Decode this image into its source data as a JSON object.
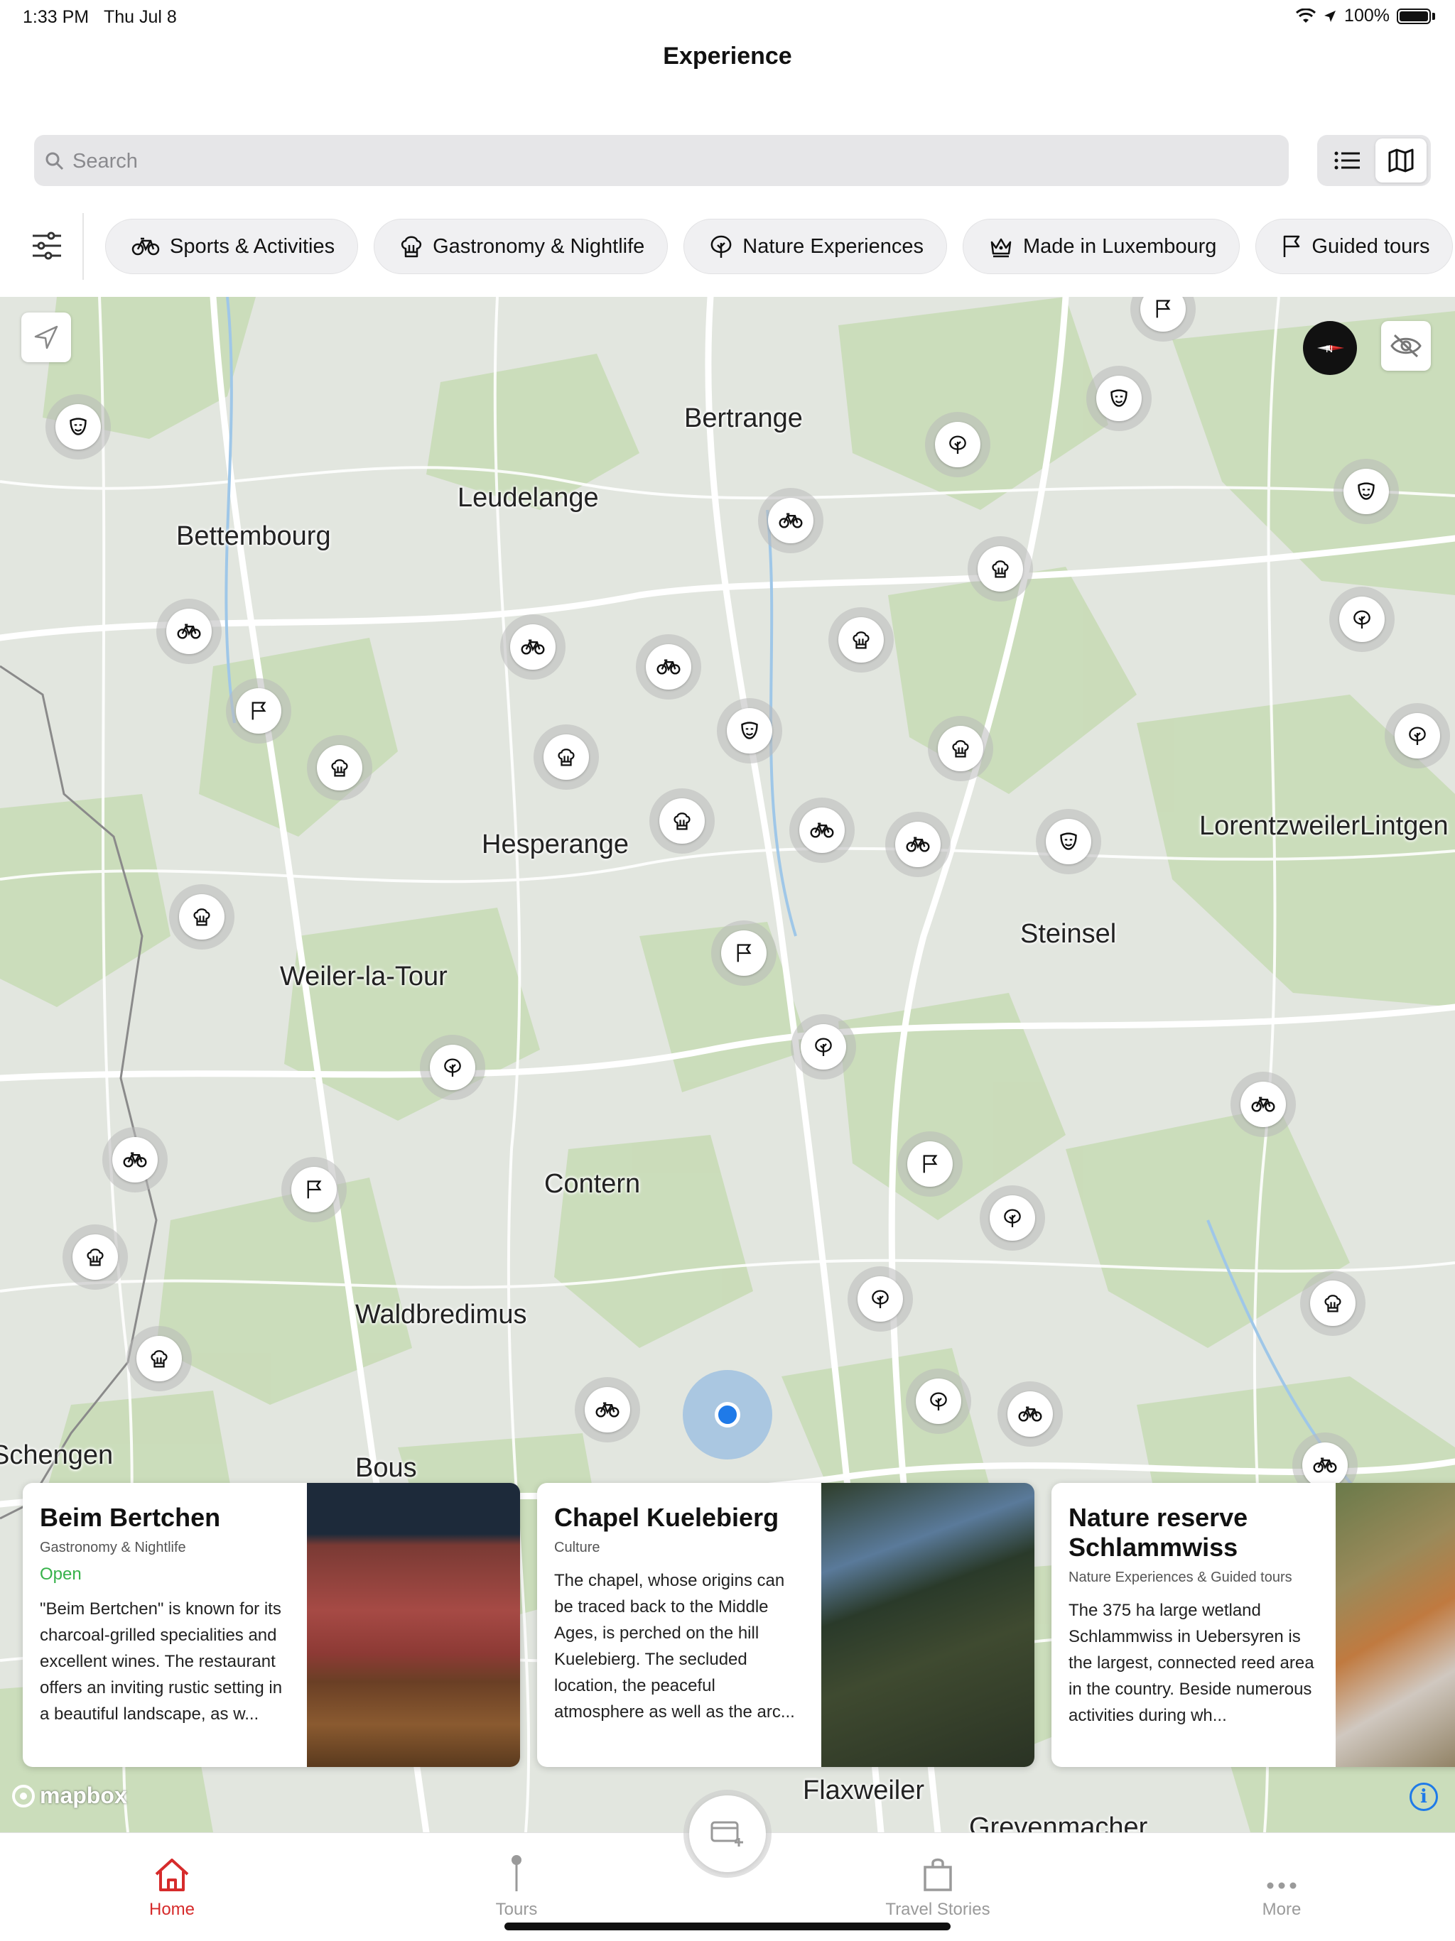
{
  "status_bar": {
    "time": "1:33 PM",
    "date": "Thu Jul 8",
    "battery": "100%"
  },
  "header": {
    "title": "Experience"
  },
  "search": {
    "placeholder": "Search",
    "value": ""
  },
  "view_toggle": {
    "options": [
      "list-icon",
      "map-icon"
    ],
    "selected": "map"
  },
  "categories": [
    {
      "label": "Sports & Activities",
      "icon": "bike-icon"
    },
    {
      "label": "Gastronomy & Nightlife",
      "icon": "chef-hat-icon"
    },
    {
      "label": "Nature Experiences",
      "icon": "tree-icon"
    },
    {
      "label": "Made in Luxembourg",
      "icon": "crown-icon"
    },
    {
      "label": "Guided tours",
      "icon": "flag-icon"
    }
  ],
  "map": {
    "places": [
      "Bertrange",
      "Leudelange",
      "Bettembourg",
      "Hesperange",
      "LorentzweilerLintgen",
      "Steinsel",
      "Weiler-la-Tour",
      "Contern",
      "Waldbredimus",
      "Schengen",
      "Bous",
      "Flaxweiler",
      "Grevenmacher"
    ],
    "attribution": "mapbox",
    "compass_label": "N"
  },
  "cards": [
    {
      "name": "Beim Bertchen",
      "category": "Gastronomy & Nightlife",
      "status": "Open",
      "description": "\"Beim Bertchen\" is known for its charcoal-grilled specialities and excellent wines. The restaurant offers an inviting rustic setting in a beautiful landscape, as w..."
    },
    {
      "name": "Chapel Kuelebierg",
      "category": "Culture",
      "description": "The chapel, whose origins can be traced back to the Middle Ages, is perched on the hill Kuelebierg. The secluded location, the peaceful atmosphere as well as the arc..."
    },
    {
      "name": "Nature reserve Schlammwiss",
      "category": "Nature Experiences & Guided tours",
      "description": "The 375 ha large wetland Schlammwiss in Uebersyren is the largest, connected reed area in the country. Beside numerous activities during wh..."
    }
  ],
  "tabbar": {
    "tabs": [
      {
        "label": "Home",
        "icon": "home-icon",
        "active": true
      },
      {
        "label": "Tours",
        "icon": "pin-icon",
        "active": false
      },
      {
        "label": "Travel Stories",
        "icon": "bag-icon",
        "active": false
      },
      {
        "label": "More",
        "icon": "more-icon",
        "active": false
      }
    ]
  },
  "colors": {
    "accent": "#d62b2b",
    "location": "#1f7ae8",
    "open": "#36b24a"
  }
}
